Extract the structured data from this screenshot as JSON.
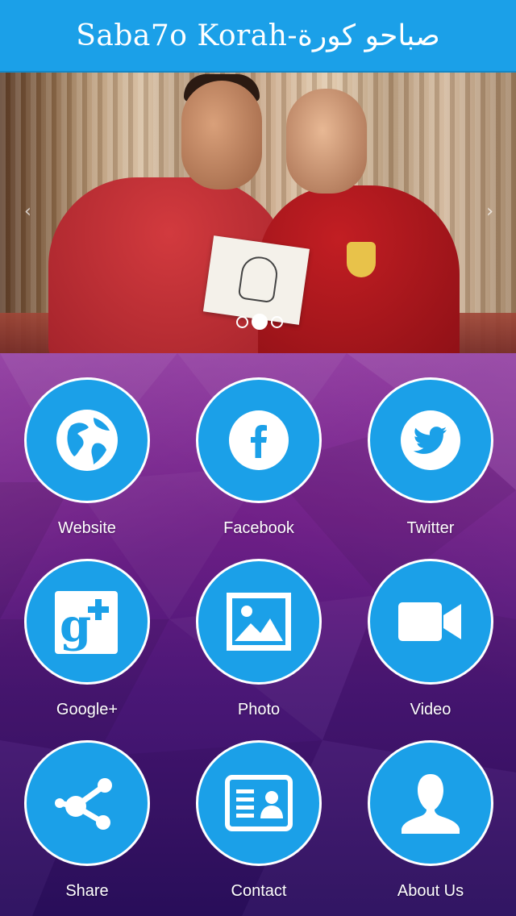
{
  "header": {
    "title": "Saba7o Korah-صباحو كورة"
  },
  "slider": {
    "prev_glyph": "‹",
    "next_glyph": "›",
    "slide_count": 3,
    "active_slide": 2
  },
  "tiles": [
    {
      "label": "Website",
      "icon": "globe-icon"
    },
    {
      "label": "Facebook",
      "icon": "facebook-icon"
    },
    {
      "label": "Twitter",
      "icon": "twitter-icon"
    },
    {
      "label": "Google+",
      "icon": "google-plus-icon"
    },
    {
      "label": "Photo",
      "icon": "photo-icon"
    },
    {
      "label": "Video",
      "icon": "video-camera-icon"
    },
    {
      "label": "Share",
      "icon": "share-icon"
    },
    {
      "label": "Contact",
      "icon": "contact-card-icon"
    },
    {
      "label": "About Us",
      "icon": "person-icon"
    }
  ],
  "colors": {
    "header": "#1ba0e8",
    "circle": "#1ba0e8",
    "label": "#ffffff",
    "background_top": "#8a2f9a",
    "background_bottom": "#2b0f5e"
  }
}
